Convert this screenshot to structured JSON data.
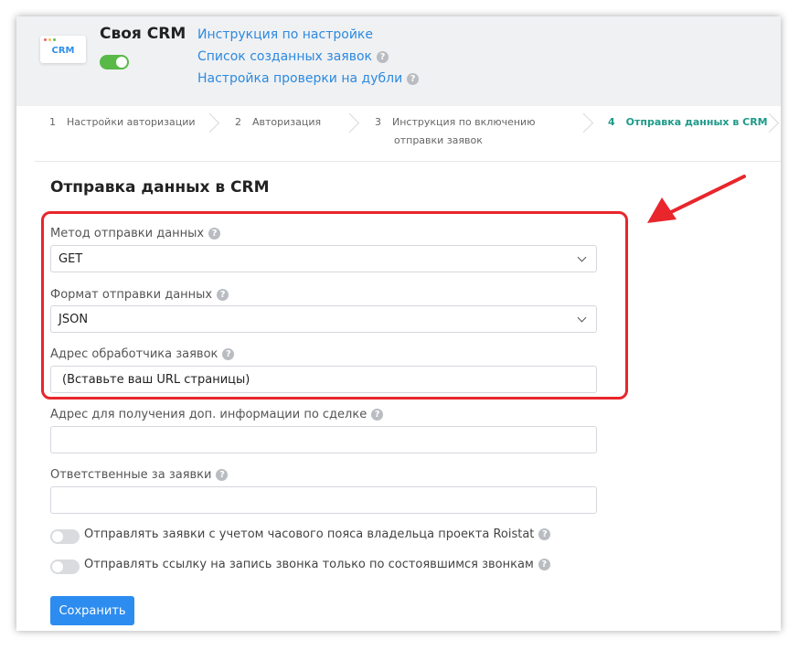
{
  "app": {
    "title": "Своя CRM",
    "logo_text": "CRM",
    "enabled": true
  },
  "header_links": [
    {
      "label": "Инструкция по настройке",
      "help": false
    },
    {
      "label": "Список созданных заявок",
      "help": true
    },
    {
      "label": "Настройка проверки на дубли",
      "help": true
    }
  ],
  "steps": [
    {
      "num": "1",
      "label": "Настройки авторизации",
      "label2": ""
    },
    {
      "num": "2",
      "label": "Авторизация",
      "label2": ""
    },
    {
      "num": "3",
      "label": "Инструкция по включению",
      "label2": "отправки заявок"
    },
    {
      "num": "4",
      "label": "Отправка данных в CRM",
      "label2": "",
      "active": true
    }
  ],
  "section": {
    "title": "Отправка данных в CRM"
  },
  "fields": {
    "method": {
      "label": "Метод отправки данных",
      "value": "GET"
    },
    "format": {
      "label": "Формат отправки данных",
      "value": "JSON"
    },
    "handler": {
      "label": "Адрес обработчика заявок",
      "value": "(Вставьте ваш URL страницы)"
    },
    "deal_info": {
      "label": "Адрес для получения доп. информации по сделке",
      "value": ""
    },
    "responsible": {
      "label": "Ответственные за заявки",
      "value": ""
    }
  },
  "toggles": {
    "timezone": {
      "label": "Отправлять заявки с учетом часового пояса владельца проекта Roistat",
      "on": false
    },
    "call_link": {
      "label": "Отправлять ссылку на запись звонка только по состоявшимся звонкам",
      "on": false
    }
  },
  "help_glyph": "?",
  "save_label": "Сохранить",
  "colors": {
    "link": "#2d8ae0",
    "active_step": "#1e9a8a",
    "toggle_on": "#58b947",
    "primary_button": "#2d8cf0",
    "annotation": "#e8262c"
  }
}
